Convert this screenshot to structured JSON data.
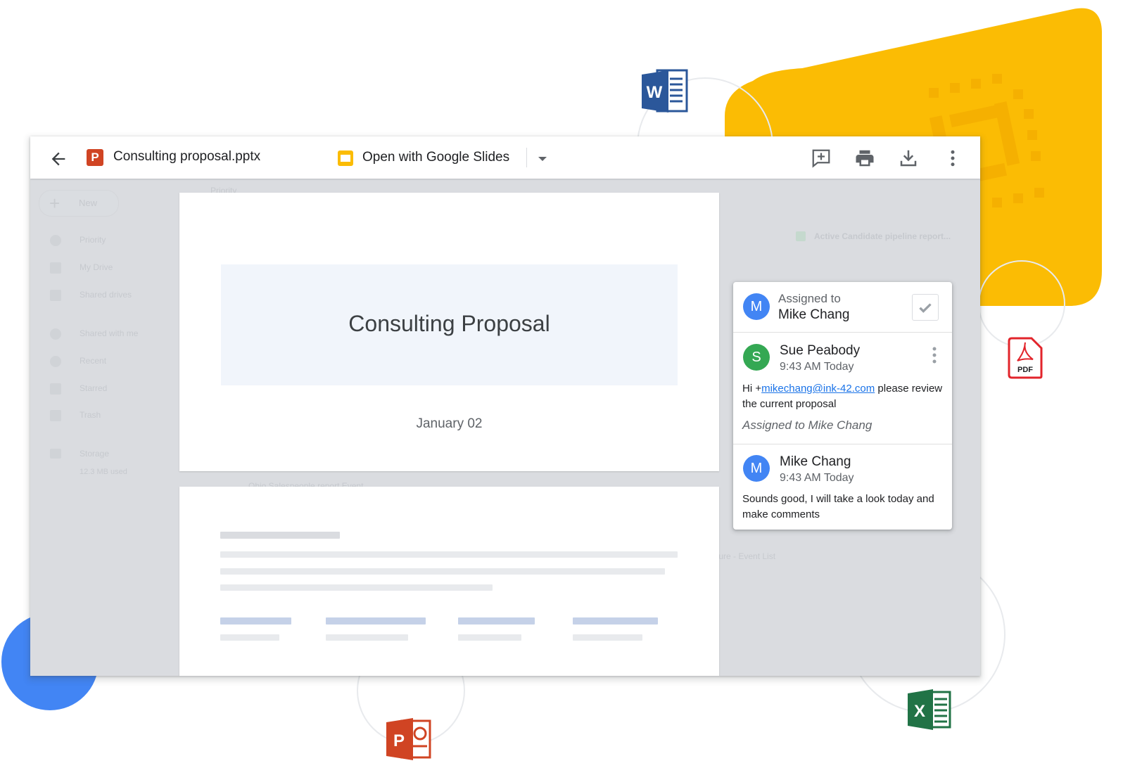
{
  "toolbar": {
    "file_name": "Consulting proposal.pptx",
    "file_badge": "P",
    "open_with_label": "Open with Google Slides"
  },
  "sidebar_ghost": {
    "new_label": "New",
    "items": [
      "Priority",
      "My Drive",
      "Shared drives",
      "Shared with me",
      "Recent",
      "Starred",
      "Trash",
      "Storage"
    ],
    "storage_used": "12.3 MB used"
  },
  "background_ghost": {
    "section_label": "Priority",
    "card_title": "Active Candidate pipeline report...",
    "list_label": "Ohio Salespeople report Event",
    "event_label": "ture - Event List"
  },
  "slide": {
    "title": "Consulting Proposal",
    "date": "January 02"
  },
  "comment_card": {
    "assign_label": "Assigned to",
    "assignee": "Mike Chang",
    "assignee_initial": "M",
    "comments": [
      {
        "initial": "S",
        "author": "Sue Peabody",
        "time": "9:43 AM Today",
        "body_prefix": "Hi +",
        "mention": "mikechang@ink-42.com",
        "body_suffix": " please review the current proposal",
        "assigned_note": "Assigned to Mike Chang"
      },
      {
        "initial": "M",
        "author": "Mike Chang",
        "time": "9:43 AM Today",
        "body": "Sounds good, I will take a look today and make comments"
      }
    ]
  },
  "floating_icons": {
    "word": "W",
    "excel": "X",
    "powerpoint": "P",
    "pdf": "PDF"
  },
  "colors": {
    "accent_blue": "#4285f4",
    "yellow": "#fbbc04",
    "sue_avatar": "#34a853",
    "ppt_red": "#d04423",
    "word_blue": "#2b579a",
    "excel_green": "#217346",
    "pdf_red": "#e2242b"
  }
}
